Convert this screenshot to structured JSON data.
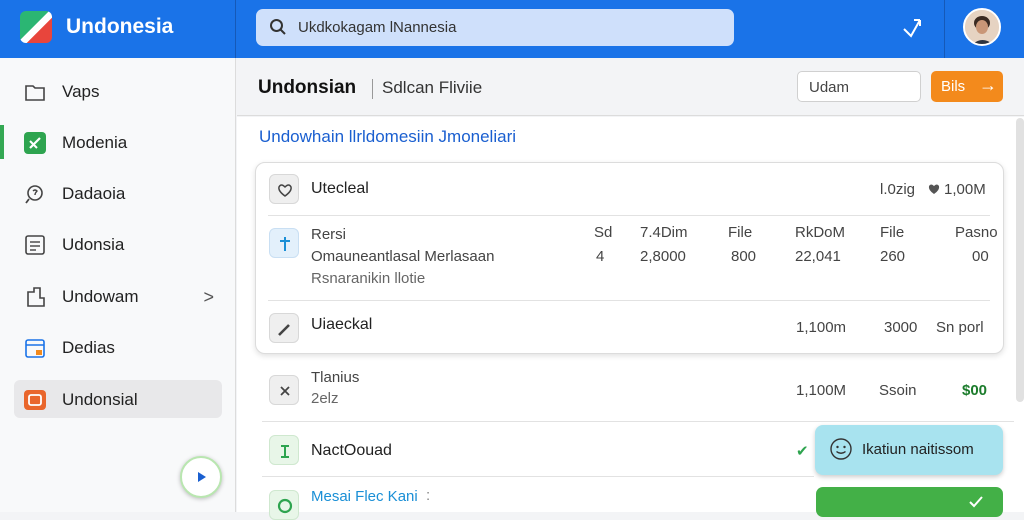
{
  "header": {
    "app_title": "Undonesia",
    "search_text": "Ukdkokagam lNannesia",
    "search_icon": "search-icon",
    "share_icon": "share-icon"
  },
  "sidebar": {
    "items": [
      {
        "label": "Vaps",
        "icon": "folder-icon"
      },
      {
        "label": "Modenia",
        "icon": "green-edit-icon"
      },
      {
        "label": "Dadaoia",
        "icon": "search-settings-icon"
      },
      {
        "label": "Udonsia",
        "icon": "list-icon"
      },
      {
        "label": "Undowam",
        "icon": "document-icon",
        "chevron": ">"
      },
      {
        "label": "Dedias",
        "icon": "calendar-icon"
      },
      {
        "label": "Undonsial",
        "icon": "orange-tag-icon"
      }
    ]
  },
  "main": {
    "title": "Undonsian",
    "subtitle": "Sdlcan Fliviie",
    "input_value": "Udam",
    "button_label": "Bils",
    "button_arrow": "→",
    "section_title": "Undowhain llrldomesiin Jmoneliari"
  },
  "card": {
    "row1": {
      "title": "Utecleal",
      "meta": "l.0zig",
      "value": "1,00M"
    },
    "headers": [
      "Sd",
      "7.4Dim",
      "File",
      "RkDoM",
      "File",
      "Pasno"
    ],
    "row2": {
      "label": "Rersi",
      "desc": "Omauneantlasal Merlasaan",
      "desc2": "Rsnaranikin llotie",
      "values": [
        "4",
        "2,8000",
        "800",
        "22,041",
        "260",
        "00"
      ]
    },
    "row3": {
      "title": "Uiaeckal",
      "v1": "1,100m",
      "v2": "3000",
      "v3": "Sn porl"
    }
  },
  "list": {
    "row4": {
      "title": "Tlanius",
      "sub": "2elz",
      "v1": "1,100M",
      "v2": "Ssoin",
      "v3": "$00"
    },
    "row5": {
      "title": "NactOouad",
      "check": "✔"
    },
    "row6": {
      "title": "Mesai Flec Kani",
      "dots": ":"
    }
  },
  "toast": {
    "text": "Ikatiun naitissom"
  },
  "colors": {
    "brand": "#1a73e8",
    "accent_orange": "#f38a1c",
    "success": "#43b047",
    "link": "#1a5fd0"
  }
}
